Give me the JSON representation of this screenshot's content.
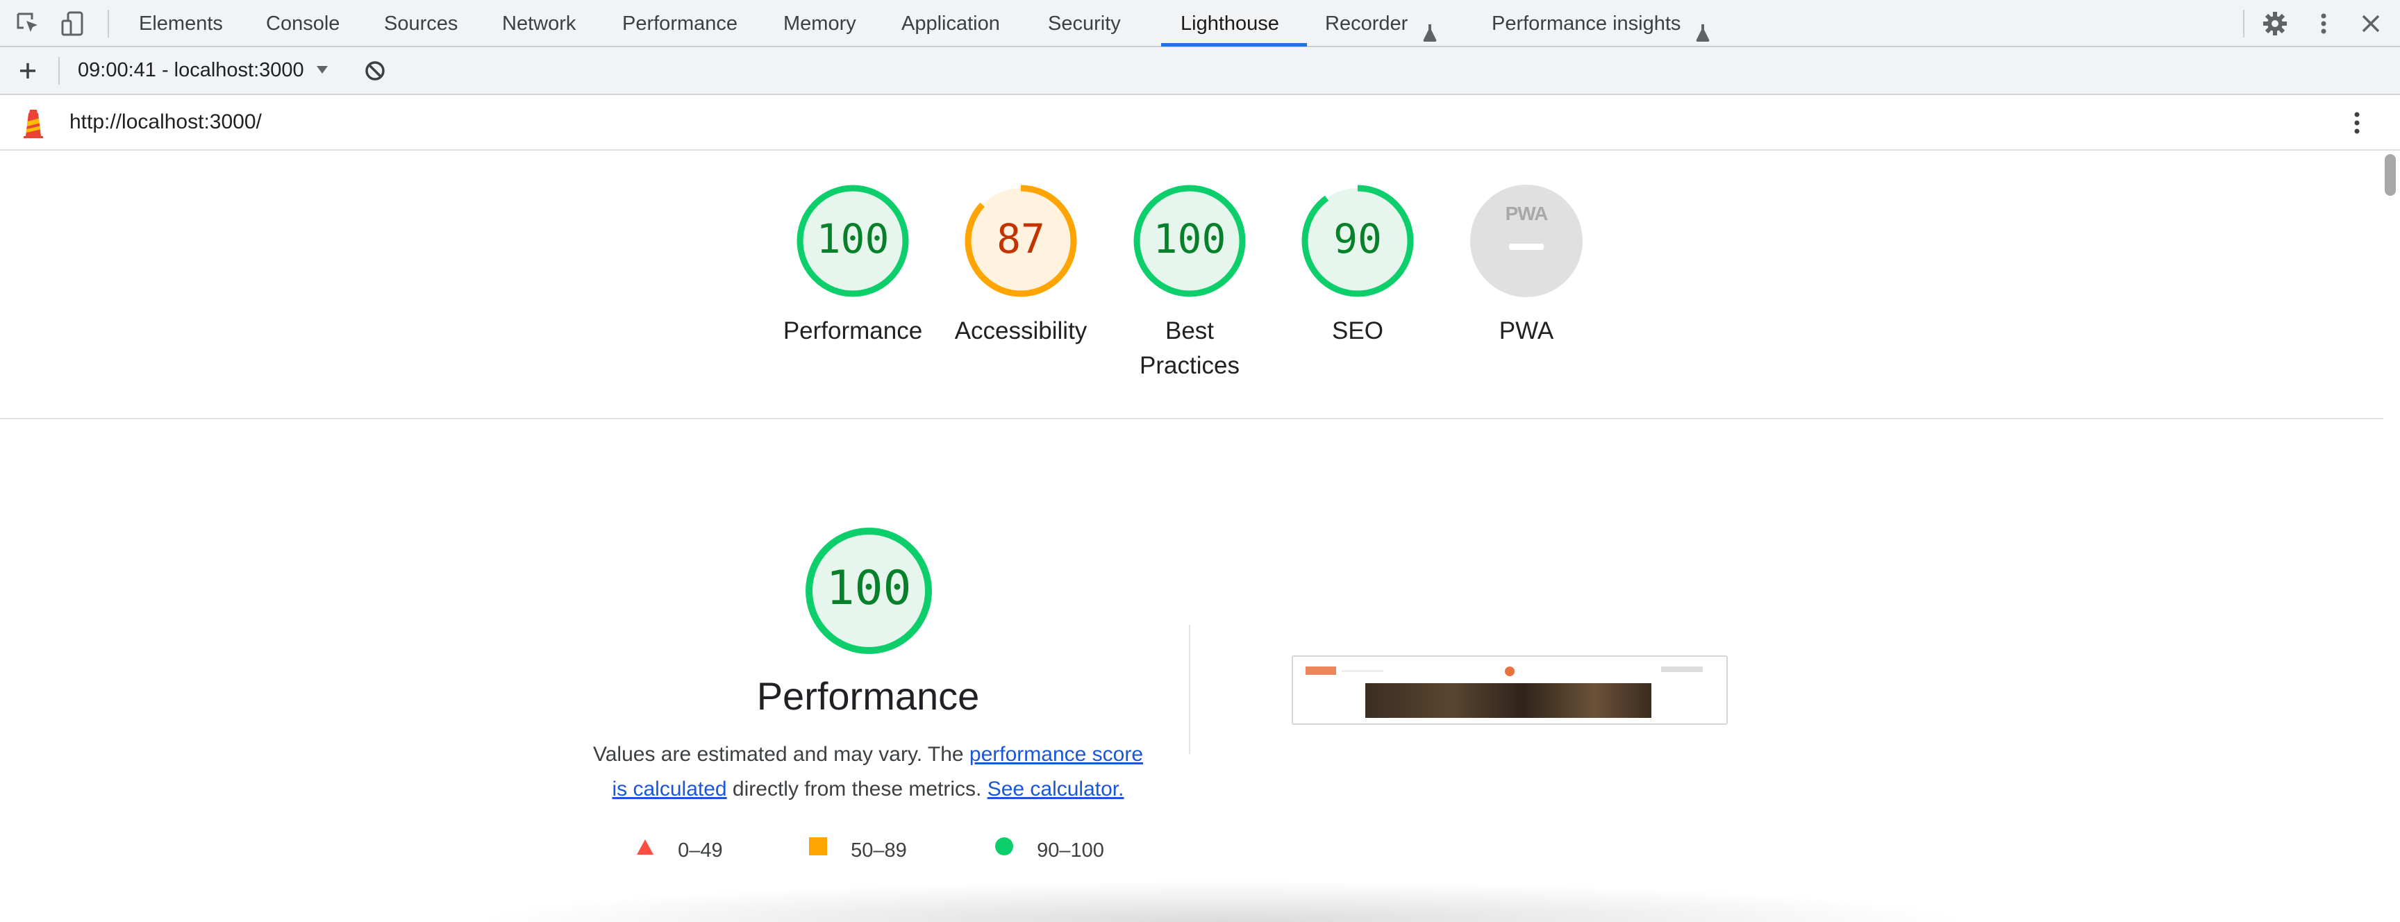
{
  "devtools": {
    "tabs": [
      {
        "label": "Elements",
        "active": false
      },
      {
        "label": "Console",
        "active": false
      },
      {
        "label": "Sources",
        "active": false
      },
      {
        "label": "Network",
        "active": false
      },
      {
        "label": "Performance",
        "active": false
      },
      {
        "label": "Memory",
        "active": false
      },
      {
        "label": "Application",
        "active": false
      },
      {
        "label": "Security",
        "active": false
      },
      {
        "label": "Lighthouse",
        "active": true
      },
      {
        "label": "Recorder",
        "active": false,
        "icon": "flask-icon"
      },
      {
        "label": "Performance insights",
        "active": false,
        "icon": "flask-icon"
      }
    ],
    "left_icons": [
      "inspect-element-icon",
      "device-toolbar-icon"
    ],
    "right_icons": [
      "gear-icon",
      "more-vertical-icon",
      "close-icon"
    ],
    "accent_color": "#1a73e8"
  },
  "toolbar": {
    "report_label": "09:00:41 - localhost:3000",
    "icons": [
      "plus-icon",
      "chevron-down-icon",
      "clear-icon"
    ]
  },
  "urlbar": {
    "url": "http://localhost:3000/",
    "icons": [
      "lighthouse-logo-icon",
      "more-vertical-icon"
    ]
  },
  "categories": [
    {
      "label": "Performance",
      "score": "100",
      "status": "pass"
    },
    {
      "label": "Accessibility",
      "score": "87",
      "status": "average"
    },
    {
      "label": "Best Practices",
      "label_lines": [
        "Best",
        "Practices"
      ],
      "score": "100",
      "status": "pass"
    },
    {
      "label": "SEO",
      "score": "90",
      "status": "pass"
    },
    {
      "label": "PWA",
      "badge": "PWA",
      "status": "neutral"
    }
  ],
  "colors": {
    "pass": "#0cce6b",
    "pass_text": "#08802b",
    "pass_fill": "#e6f6ec",
    "average": "#ffa400",
    "average_text": "#c33300",
    "average_fill": "#fff3e0",
    "fail": "#ff4e42",
    "neutral_fill": "#e0e0e0",
    "neutral_text": "#9e9e9e"
  },
  "performance": {
    "score": "100",
    "title": "Performance",
    "desc_prefix": "Values are estimated and may vary. The ",
    "link1": "performance score is calculated",
    "desc_middle": " directly from these metrics. ",
    "link2": "See calculator.",
    "legend": [
      {
        "shape": "triangle",
        "range": "0–49",
        "color": "#ff4e42"
      },
      {
        "shape": "square",
        "range": "50–89",
        "color": "#ffa400"
      },
      {
        "shape": "circle",
        "range": "90–100",
        "color": "#0cce6b"
      }
    ]
  }
}
